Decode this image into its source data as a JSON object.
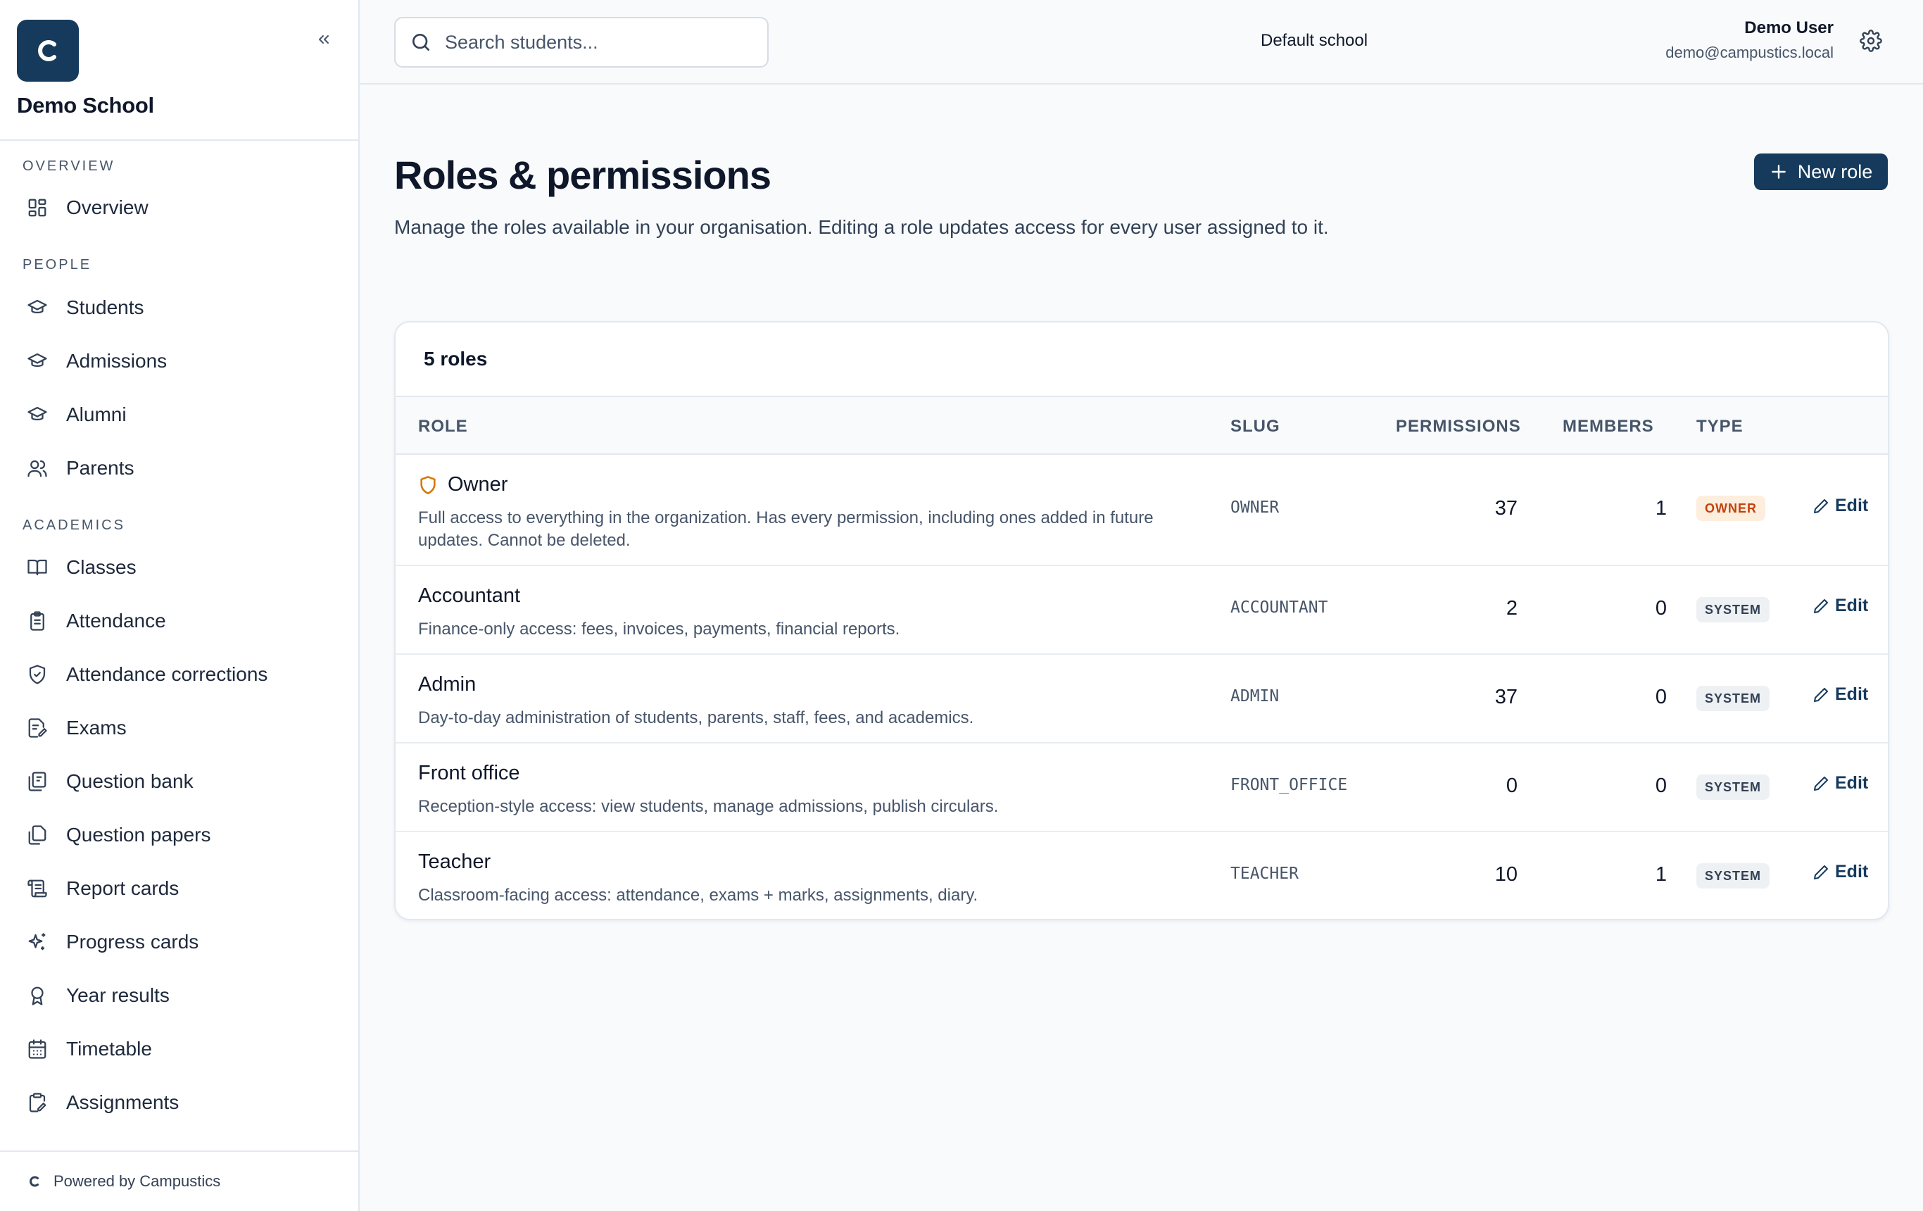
{
  "sidebar": {
    "logo_letter": "C",
    "school_name": "Demo School",
    "sections": {
      "overview": "OVERVIEW",
      "people": "PEOPLE",
      "academics": "ACADEMICS"
    },
    "items": [
      {
        "label": "Overview",
        "icon": "grid-icon"
      },
      {
        "label": "Students",
        "icon": "graduation-cap-icon"
      },
      {
        "label": "Admissions",
        "icon": "graduation-cap-icon"
      },
      {
        "label": "Alumni",
        "icon": "graduation-cap-icon"
      },
      {
        "label": "Parents",
        "icon": "users-icon"
      },
      {
        "label": "Classes",
        "icon": "book-open-icon"
      },
      {
        "label": "Attendance",
        "icon": "clipboard-list-icon"
      },
      {
        "label": "Attendance corrections",
        "icon": "shield-check-icon"
      },
      {
        "label": "Exams",
        "icon": "file-pen-icon"
      },
      {
        "label": "Question bank",
        "icon": "library-icon"
      },
      {
        "label": "Question papers",
        "icon": "files-icon"
      },
      {
        "label": "Report cards",
        "icon": "scroll-icon"
      },
      {
        "label": "Progress cards",
        "icon": "sparkles-icon"
      },
      {
        "label": "Year results",
        "icon": "award-icon"
      },
      {
        "label": "Timetable",
        "icon": "calendar-icon"
      },
      {
        "label": "Assignments",
        "icon": "clipboard-pen-icon"
      }
    ],
    "footer": "Powered by Campustics"
  },
  "topbar": {
    "search_placeholder": "Search students...",
    "school": "Default school",
    "user_name": "Demo User",
    "user_email": "demo@campustics.local"
  },
  "page": {
    "title": "Roles & permissions",
    "description": "Manage the roles available in your organisation. Editing a role updates access for every user assigned to it.",
    "new_role_label": "New role"
  },
  "table": {
    "count_label": "5 roles",
    "columns": {
      "role": "ROLE",
      "slug": "SLUG",
      "permissions": "PERMISSIONS",
      "members": "MEMBERS",
      "type": "TYPE"
    },
    "edit_label": "Edit",
    "rows": [
      {
        "name": "Owner",
        "description": "Full access to everything in the organization. Has every permission, including ones added in future updates. Cannot be deleted.",
        "slug": "OWNER",
        "permissions": "37",
        "members": "1",
        "type": "OWNER"
      },
      {
        "name": "Accountant",
        "description": "Finance-only access: fees, invoices, payments, financial reports.",
        "slug": "ACCOUNTANT",
        "permissions": "2",
        "members": "0",
        "type": "SYSTEM"
      },
      {
        "name": "Admin",
        "description": "Day-to-day administration of students, parents, staff, fees, and academics.",
        "slug": "ADMIN",
        "permissions": "37",
        "members": "0",
        "type": "SYSTEM"
      },
      {
        "name": "Front office",
        "description": "Reception-style access: view students, manage admissions, publish circulars.",
        "slug": "FRONT_OFFICE",
        "permissions": "0",
        "members": "0",
        "type": "SYSTEM"
      },
      {
        "name": "Teacher",
        "description": "Classroom-facing access: attendance, exams + marks, assignments, diary.",
        "slug": "TEACHER",
        "permissions": "10",
        "members": "1",
        "type": "SYSTEM"
      }
    ]
  },
  "colors": {
    "brand": "#163a5c",
    "owner_badge_bg": "#fdeedd",
    "owner_badge_text": "#c2410c",
    "system_badge_bg": "#eef1f4"
  }
}
